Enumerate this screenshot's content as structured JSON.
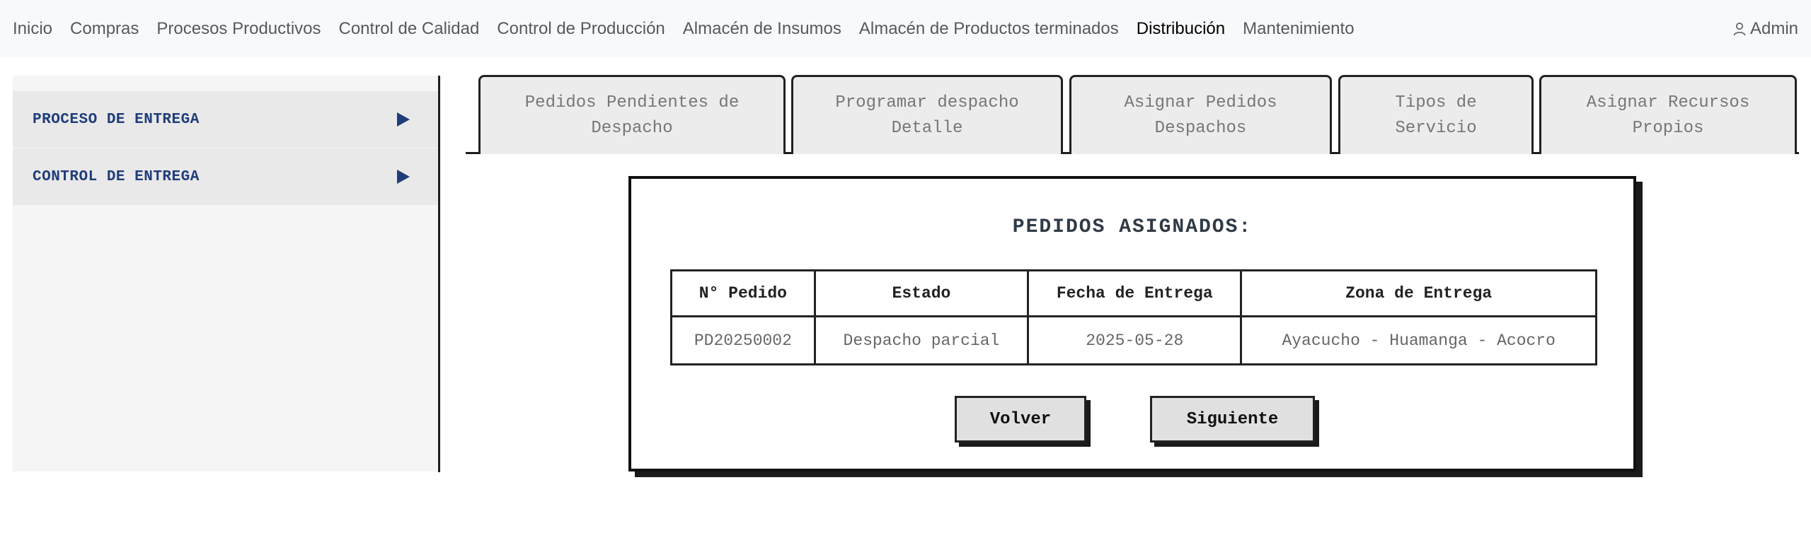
{
  "nav": {
    "items": [
      {
        "label": "Inicio"
      },
      {
        "label": "Compras"
      },
      {
        "label": "Procesos Productivos"
      },
      {
        "label": "Control de Calidad"
      },
      {
        "label": "Control de Producción"
      },
      {
        "label": "Almacén de Insumos"
      },
      {
        "label": "Almacén de Productos terminados"
      },
      {
        "label": "Distribución",
        "active": true
      },
      {
        "label": "Mantenimiento"
      }
    ],
    "user_label": "Admin",
    "user_icon": "user-icon"
  },
  "sidebar": {
    "items": [
      {
        "label": "PROCESO DE ENTREGA",
        "icon": "play-arrow-icon"
      },
      {
        "label": "CONTROL DE ENTREGA",
        "icon": "play-arrow-icon"
      }
    ]
  },
  "tabs": [
    {
      "line1": "Pedidos Pendientes de",
      "line2": "Despacho"
    },
    {
      "line1": "Programar despacho",
      "line2": "Detalle"
    },
    {
      "line1": "Asignar Pedidos",
      "line2": "Despachos"
    },
    {
      "line1": "Tipos de",
      "line2": "Servicio"
    },
    {
      "line1": "Asignar Recursos",
      "line2": "Propios"
    }
  ],
  "panel": {
    "title": "PEDIDOS ASIGNADOS:",
    "table": {
      "headers": [
        "N° Pedido",
        "Estado",
        "Fecha de Entrega",
        "Zona de Entrega"
      ],
      "rows": [
        [
          "PD20250002",
          "Despacho parcial",
          "2025-05-28",
          "Ayacucho - Huamanga - Acocro"
        ]
      ]
    },
    "buttons": {
      "back": "Volver",
      "next": "Siguiente"
    }
  },
  "colors": {
    "navbar_bg": "#f8f9fa",
    "sidebar_text": "#1f3d7a",
    "border": "#222222"
  }
}
